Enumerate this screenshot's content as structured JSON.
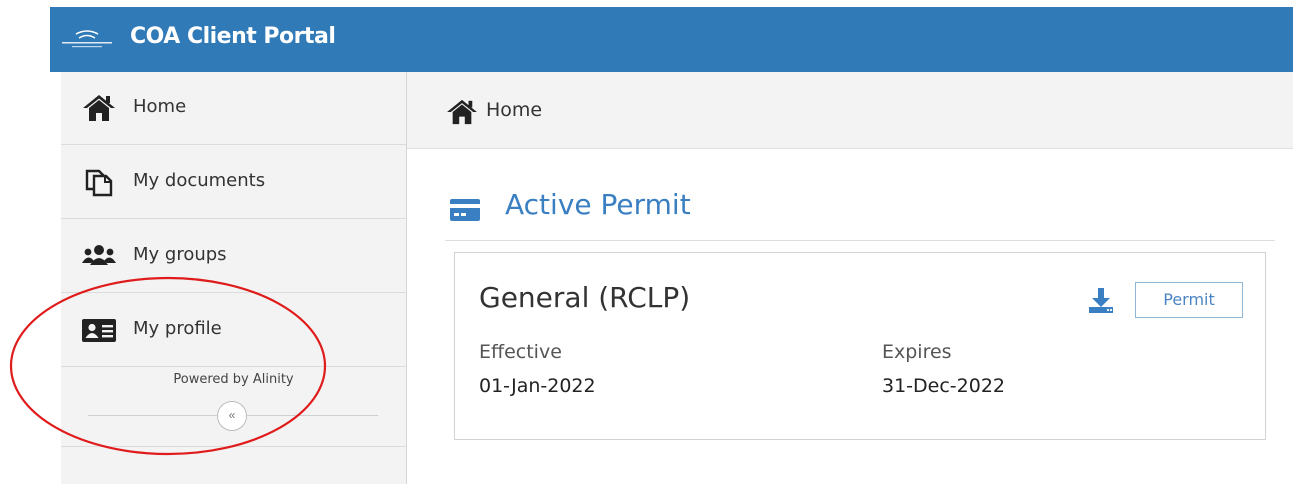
{
  "header": {
    "app_title": "COA Client Portal"
  },
  "sidebar": {
    "items": [
      {
        "label": "Home",
        "icon": "home-icon"
      },
      {
        "label": "My documents",
        "icon": "documents-icon"
      },
      {
        "label": "My groups",
        "icon": "groups-icon"
      },
      {
        "label": "My profile",
        "icon": "profile-card-icon"
      }
    ],
    "powered_by": "Powered by Alinity",
    "collapse_symbol": "«"
  },
  "breadcrumb": {
    "label": "Home",
    "icon": "home-icon"
  },
  "section": {
    "title": "Active Permit",
    "icon": "credit-card-icon"
  },
  "permit_card": {
    "title": "General (RCLP)",
    "download_icon": "download-icon",
    "permit_button": "Permit",
    "effective_label": "Effective",
    "effective_value": "01-Jan-2022",
    "expires_label": "Expires",
    "expires_value": "31-Dec-2022"
  },
  "colors": {
    "header": "#2f7ab7",
    "accent": "#3a7fc1",
    "annotation": "#e01b1b"
  }
}
